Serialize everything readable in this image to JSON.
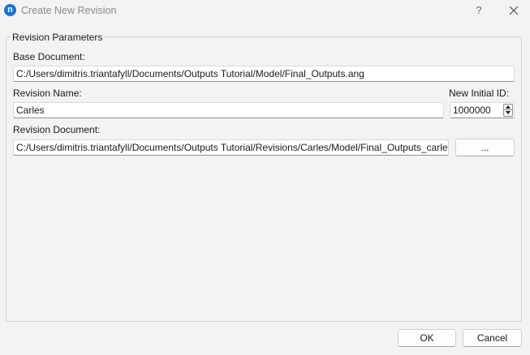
{
  "window": {
    "title": "Create New Revision",
    "app_icon": "n",
    "help_label": "?",
    "close_icon": "close-icon"
  },
  "group": {
    "title": "Revision Parameters"
  },
  "base_document": {
    "label": "Base Document:",
    "value": "C:/Users/dimitris.triantafyll/Documents/Outputs Tutorial/Model/Final_Outputs.ang"
  },
  "revision_name": {
    "label": "Revision Name:",
    "value": "Carles"
  },
  "new_initial_id": {
    "label": "New Initial ID:",
    "value": "1000000"
  },
  "revision_document": {
    "label": "Revision Document:",
    "value": "C:/Users/dimitris.triantafyll/Documents/Outputs Tutorial/Revisions/Carles/Model/Final_Outputs_carles.ang",
    "browse_label": "..."
  },
  "buttons": {
    "ok": "OK",
    "cancel": "Cancel"
  }
}
